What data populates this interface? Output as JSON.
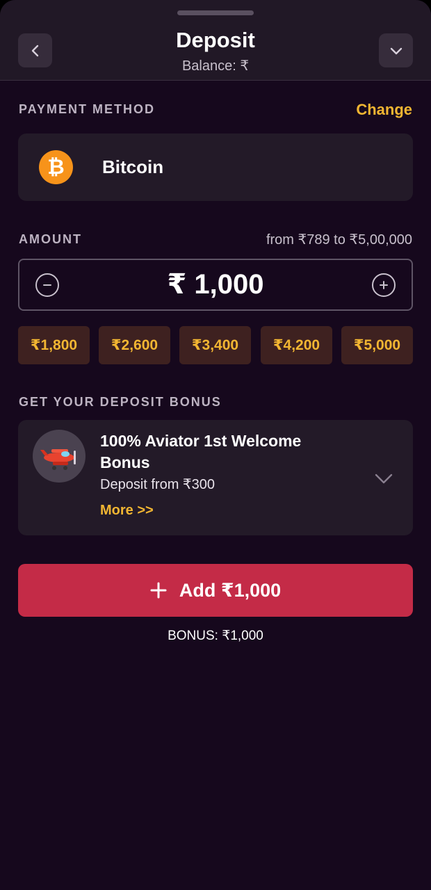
{
  "header": {
    "title": "Deposit",
    "balance": "Balance: ₹"
  },
  "payment": {
    "section_label": "PAYMENT METHOD",
    "change_label": "Change",
    "method_name": "Bitcoin",
    "method_icon": "bitcoin-icon"
  },
  "amount": {
    "section_label": "AMOUNT",
    "range": "from ₹789 to ₹5,00,000",
    "value": "₹ 1,000",
    "quick_amounts": [
      "₹1,800",
      "₹2,600",
      "₹3,400",
      "₹4,200",
      "₹5,000"
    ]
  },
  "bonus": {
    "section_label": "GET YOUR DEPOSIT BONUS",
    "title": "100% Aviator 1st Welcome Bonus",
    "subtitle": "Deposit from ₹300",
    "more_label": "More >>"
  },
  "action": {
    "add_label": "Add ₹1,000",
    "bonus_total": "BONUS: ₹1,000"
  },
  "colors": {
    "background": "#16081d",
    "card": "#231a28",
    "accent": "#f2b632",
    "primary_button": "#c42b47",
    "bitcoin": "#f7931a"
  }
}
